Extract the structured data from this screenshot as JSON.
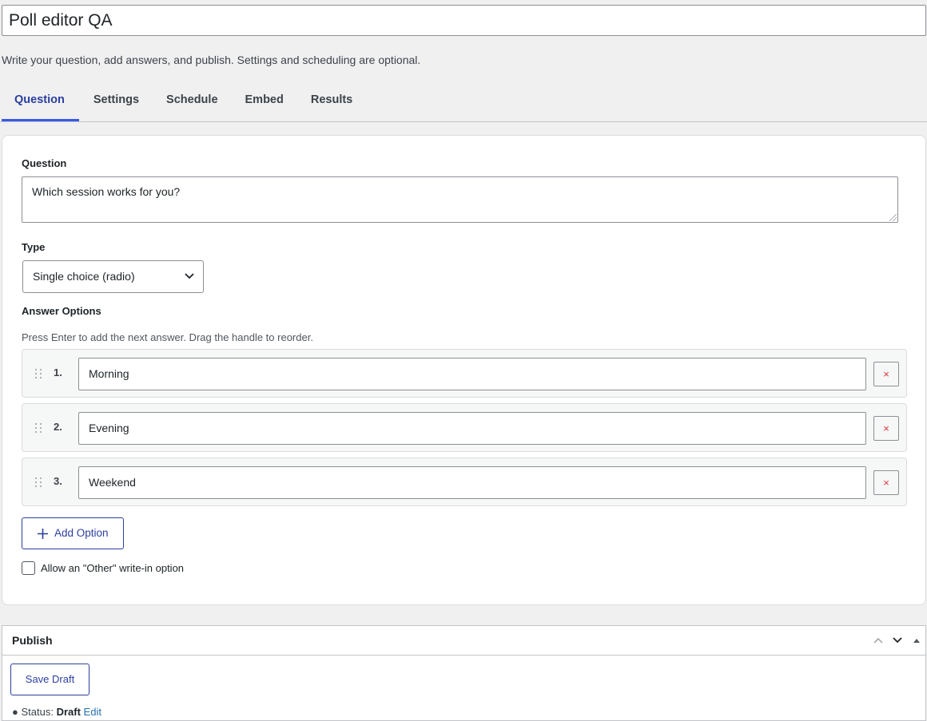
{
  "title": "Poll editor QA",
  "description": "Write your question, add answers, and publish. Settings and scheduling are optional.",
  "tabs": [
    {
      "label": "Question",
      "active": true
    },
    {
      "label": "Settings",
      "active": false
    },
    {
      "label": "Schedule",
      "active": false
    },
    {
      "label": "Embed",
      "active": false
    },
    {
      "label": "Results",
      "active": false
    }
  ],
  "question": {
    "label": "Question",
    "value": "Which session works for you?"
  },
  "type": {
    "label": "Type",
    "selected": "Single choice (radio)"
  },
  "answers": {
    "label": "Answer Options",
    "hint": "Press Enter to add the next answer. Drag the handle to reorder.",
    "items": [
      {
        "number": "1.",
        "value": "Morning"
      },
      {
        "number": "2.",
        "value": "Evening"
      },
      {
        "number": "3.",
        "value": "Weekend"
      }
    ],
    "remove_symbol": "×",
    "add_label": "Add Option"
  },
  "other_option": {
    "label": "Allow an \"Other\" write-in option",
    "checked": false
  },
  "publish": {
    "title": "Publish",
    "save_draft_label": "Save Draft",
    "status_label": "Status:",
    "status_value": "Draft",
    "status_edit": "Edit"
  },
  "colors": {
    "accent": "#3858e9",
    "accent_dark": "#2c3f9e",
    "danger": "#d63638",
    "background": "#f0f0f1"
  }
}
